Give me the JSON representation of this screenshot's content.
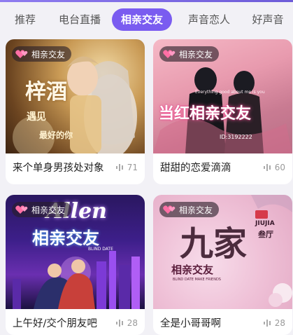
{
  "tabs": [
    {
      "label": "推荐"
    },
    {
      "label": "电台直播"
    },
    {
      "label": "相亲交友"
    },
    {
      "label": "声音恋人"
    },
    {
      "label": "好声音"
    }
  ],
  "active_tab": "相亲交友",
  "accent_color": "#7a5cf0",
  "cards": [
    {
      "badge": "相亲交友",
      "title": "来个单身男孩处对象",
      "count": "71",
      "cover": {
        "text1": "梓酒",
        "text2": "遇见",
        "text3": "最好的你"
      }
    },
    {
      "badge": "相亲交友",
      "title": "甜甜的恋爱滴滴",
      "count": "60",
      "cover": {
        "text1": "当红相亲交友",
        "text2": "ID:3192222",
        "text3": "Everything good about me is you"
      }
    },
    {
      "badge": "相亲交友",
      "title": "上午好/交个朋友吧",
      "count": "28",
      "cover": {
        "text1": "Allen",
        "text2": "相亲交友",
        "text3": "BLIND DATE"
      }
    },
    {
      "badge": "相亲交友",
      "title": "全是小哥哥啊",
      "count": "28",
      "cover": {
        "text1": "九家",
        "text2": "相亲交友",
        "text3": "JIUJIA",
        "text4": "叁厅",
        "text5": "BLIND DATE MAKE FRIENDS"
      }
    }
  ]
}
